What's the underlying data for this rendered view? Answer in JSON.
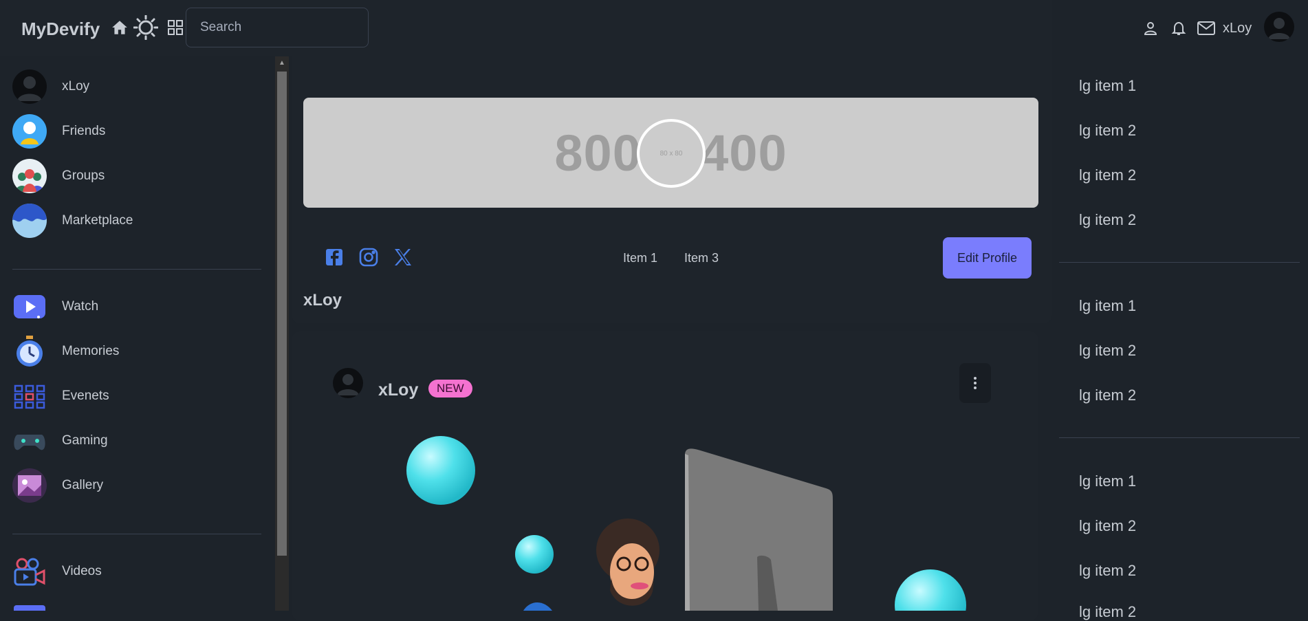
{
  "header": {
    "brand": "MyDevify",
    "search_placeholder": "Search",
    "username": "xLoy"
  },
  "sidebar": {
    "items": [
      {
        "label": "xLoy",
        "icon": "user-avatar-icon"
      },
      {
        "label": "Friends",
        "icon": "friends-icon"
      },
      {
        "label": "Groups",
        "icon": "groups-icon"
      },
      {
        "label": "Marketplace",
        "icon": "marketplace-icon"
      },
      {
        "label": "Watch",
        "icon": "watch-icon"
      },
      {
        "label": "Memories",
        "icon": "memories-icon"
      },
      {
        "label": "Evenets",
        "icon": "events-icon"
      },
      {
        "label": "Gaming",
        "icon": "gaming-icon"
      },
      {
        "label": "Gallery",
        "icon": "gallery-icon"
      },
      {
        "label": "Videos",
        "icon": "videos-icon"
      }
    ]
  },
  "profile": {
    "cover_text": "800 x 400",
    "avatar_text": "80 x 80",
    "tabs": [
      "Item 1",
      "Item 3"
    ],
    "edit_label": "Edit Profile",
    "name": "xLoy"
  },
  "post": {
    "author": "xLoy",
    "badge": "NEW"
  },
  "right_list": {
    "items": [
      "lg item 1",
      "lg item 2",
      "lg item 2",
      "lg item 2",
      "lg item 1",
      "lg item 2",
      "lg item 2",
      "lg item 1",
      "lg item 2",
      "lg item 2",
      "lg item 2"
    ]
  },
  "colors": {
    "background": "#1d232a",
    "accent": "#7a7dfd",
    "badge": "#f472d0",
    "social": "#4a7fe8"
  }
}
